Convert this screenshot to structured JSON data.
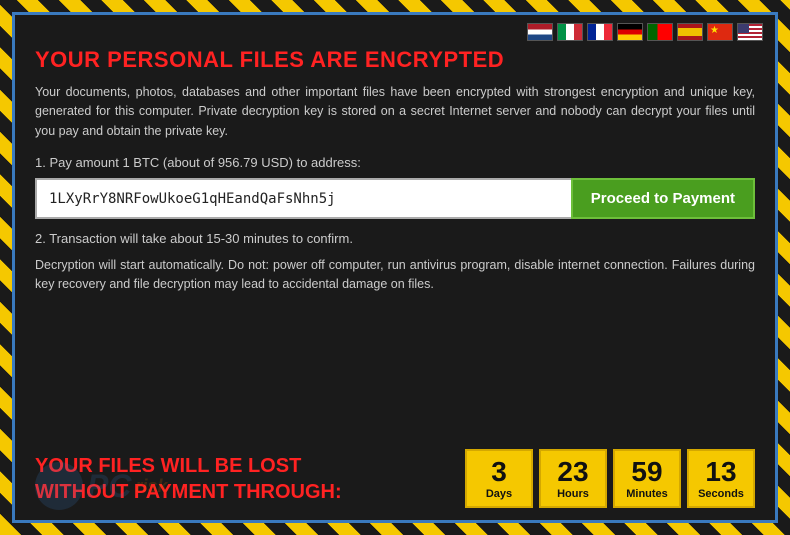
{
  "flags": [
    {
      "id": "nl",
      "title": "Dutch",
      "class": "flag-nl"
    },
    {
      "id": "it",
      "title": "Italian",
      "class": "flag-it"
    },
    {
      "id": "fr",
      "title": "French",
      "class": "flag-fr"
    },
    {
      "id": "de",
      "title": "German",
      "class": "flag-de"
    },
    {
      "id": "pt",
      "title": "Portuguese",
      "class": "flag-pt"
    },
    {
      "id": "es",
      "title": "Spanish",
      "class": "flag-es"
    },
    {
      "id": "cn",
      "title": "Chinese",
      "class": "flag-cn"
    },
    {
      "id": "us",
      "title": "English",
      "class": "flag-us"
    }
  ],
  "title": "YOUR PERSONAL FILES ARE ENCRYPTED",
  "description": "Your documents, photos, databases and other important files have been encrypted with strongest encryption and unique key, generated for this computer. Private decryption key is stored on a secret Internet server and nobody can decrypt your files until you pay and obtain the private key.",
  "step1_label": "1. Pay amount 1 BTC (about of 956.79 USD) to address:",
  "btc_address": "1LXyRrY8NRFowUkoeG1qHEandQaFsNhn5j",
  "proceed_btn": "Proceed to Payment",
  "step2_label": "2. Transaction will take about 15-30 minutes to confirm.",
  "warning": "Decryption will start automatically. Do not: power off computer, run antivirus program, disable internet connection. Failures during key recovery and file decryption may lead to accidental damage on files.",
  "files_lost_line1": "YOUR FILES WILL BE LOST",
  "files_lost_line2": "WITHOUT PAYMENT THROUGH:",
  "countdown": [
    {
      "number": "3",
      "label": "Days"
    },
    {
      "number": "23",
      "label": "Hours"
    },
    {
      "number": "59",
      "label": "Minutes"
    },
    {
      "number": "13",
      "label": "Seconds"
    }
  ],
  "watermark": {
    "icon": "PC",
    "text": "PC",
    "sub": "risk"
  }
}
